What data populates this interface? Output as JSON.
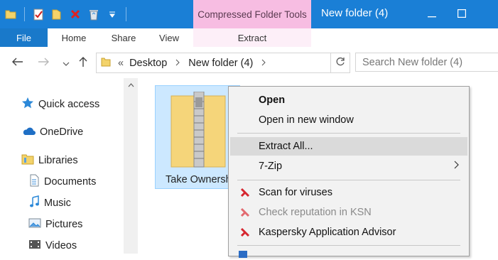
{
  "titlebar": {
    "contextual_header": "Compressed Folder Tools",
    "window_title": "New folder (4)",
    "minimize_icon": "minimize-icon",
    "maximize_icon": "maximize-icon",
    "accent": "#1a7fd6"
  },
  "ribbon": {
    "tabs": [
      "File",
      "Home",
      "Share",
      "View"
    ],
    "contextual_tab": "Extract"
  },
  "address": {
    "overflow": "«",
    "segments": [
      "Desktop",
      "New folder (4)"
    ],
    "search_placeholder": "Search New folder (4)"
  },
  "navpane": {
    "items": [
      {
        "label": "Quick access",
        "icon": "star-icon"
      },
      {
        "label": "OneDrive",
        "icon": "cloud-icon"
      },
      {
        "label": "Libraries",
        "icon": "library-icon"
      },
      {
        "label": "Documents",
        "icon": "documents-icon"
      },
      {
        "label": "Music",
        "icon": "music-icon"
      },
      {
        "label": "Pictures",
        "icon": "pictures-icon"
      },
      {
        "label": "Videos",
        "icon": "videos-icon"
      }
    ]
  },
  "content": {
    "file_name": "Take Ownership"
  },
  "context_menu": {
    "items": [
      {
        "label": "Open"
      },
      {
        "label": "Open in new window"
      },
      {
        "label": "Extract All..."
      },
      {
        "label": "7-Zip"
      },
      {
        "label": "Scan for viruses"
      },
      {
        "label": "Check reputation in KSN"
      },
      {
        "label": "Kaspersky Application Advisor"
      }
    ]
  }
}
